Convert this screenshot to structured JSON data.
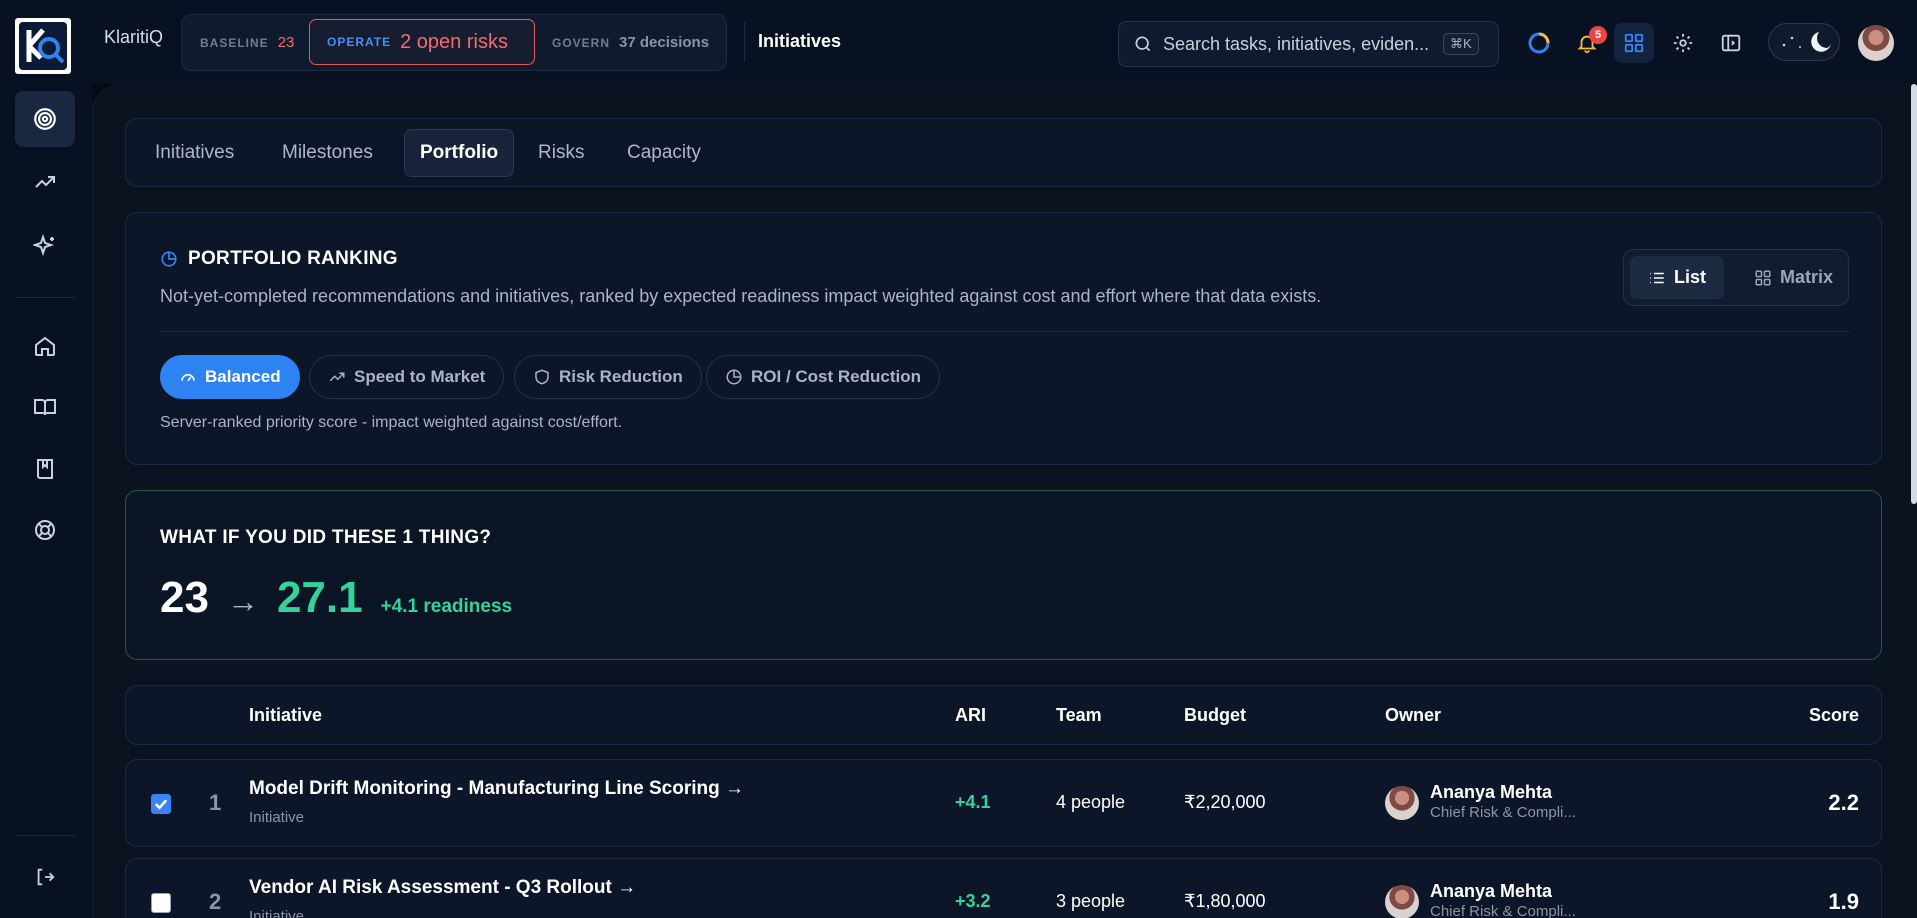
{
  "app": {
    "brand": "KlaritiQ",
    "phases": [
      {
        "tag": "BASELINE",
        "value": "23"
      },
      {
        "tag": "OPERATE",
        "value": "2 open risks"
      },
      {
        "tag": "GOVERN",
        "value": "37 decisions"
      }
    ],
    "breadcrumb": "Initiatives",
    "search_placeholder": "Search tasks, initiatives, eviden...",
    "search_shortcut": "⌘K",
    "notification_count": "5",
    "accent_color": "#2d83f2",
    "positive_color": "#34d399",
    "alert_color": "#f26b70"
  },
  "sidebar": {
    "items": [
      {
        "icon": "target-icon"
      },
      {
        "icon": "trending-up-icon"
      },
      {
        "icon": "sparkles-icon"
      },
      {
        "icon": "home-icon"
      },
      {
        "icon": "book-open-icon"
      },
      {
        "icon": "bookmark-book-icon"
      },
      {
        "icon": "lifebuoy-icon"
      }
    ],
    "bottom": {
      "icon": "logout-icon"
    }
  },
  "tabs": [
    "Initiatives",
    "Milestones",
    "Portfolio",
    "Risks",
    "Capacity"
  ],
  "active_tab": "Portfolio",
  "ranking": {
    "title": "PORTFOLIO RANKING",
    "description": "Not-yet-completed recommendations and initiatives, ranked by expected readiness impact weighted against cost and effort where that data exists.",
    "views": [
      "List",
      "Matrix"
    ],
    "active_view": "List",
    "strategies": [
      "Balanced",
      "Speed to Market",
      "Risk Reduction",
      "ROI / Cost Reduction"
    ],
    "active_strategy": "Balanced",
    "note": "Server-ranked priority score - impact weighted against cost/effort."
  },
  "whatif": {
    "title": "WHAT IF YOU DID THESE 1 THING?",
    "from": "23",
    "arrow": "→",
    "to": "27.1",
    "delta": "+4.1 readiness"
  },
  "table": {
    "headers": {
      "initiative": "Initiative",
      "ari": "ARI",
      "team": "Team",
      "budget": "Budget",
      "owner": "Owner",
      "score": "Score"
    },
    "rows": [
      {
        "checked": true,
        "rank": "1",
        "name": "Model Drift Monitoring - Manufacturing Line Scoring →",
        "type": "Initiative",
        "ari": "+4.1",
        "team": "4 people",
        "budget": "₹2,20,000",
        "owner": "Ananya Mehta",
        "role": "Chief Risk & Compli...",
        "score": "2.2"
      },
      {
        "checked": false,
        "rank": "2",
        "name": "Vendor AI Risk Assessment - Q3 Rollout →",
        "type": "Initiative",
        "ari": "+3.2",
        "team": "3 people",
        "budget": "₹1,80,000",
        "owner": "Ananya Mehta",
        "role": "Chief Risk & Compli...",
        "score": "1.9"
      }
    ]
  }
}
